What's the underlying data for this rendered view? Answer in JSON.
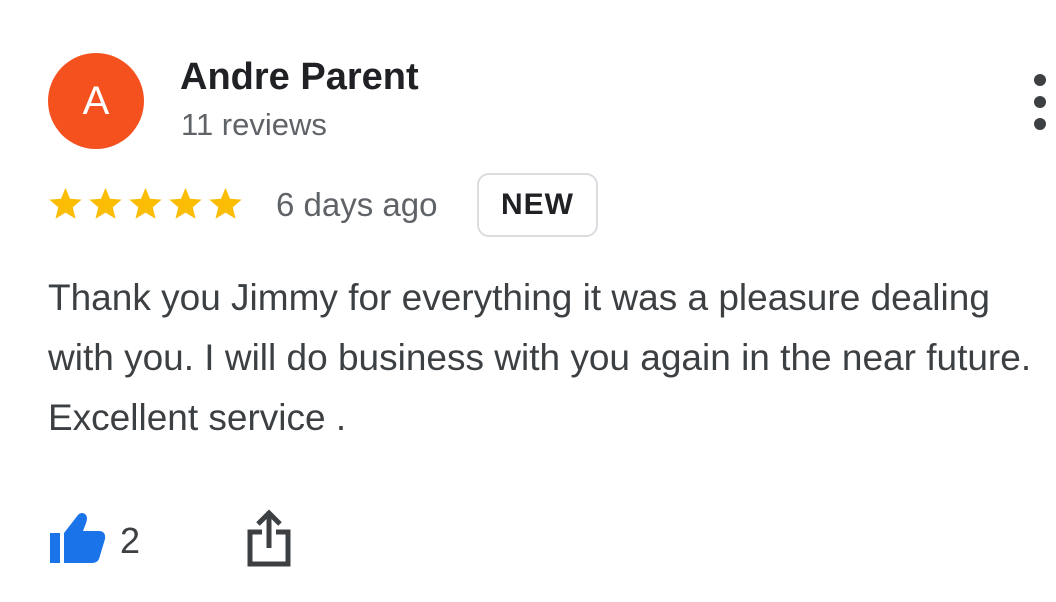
{
  "reviewer": {
    "initial": "A",
    "name": "Andre Parent",
    "review_count": "11 reviews",
    "avatar_color": "#f4511e"
  },
  "rating": {
    "stars": 5,
    "max_stars": 5,
    "star_color": "#fbbc04"
  },
  "review": {
    "date": "6 days ago",
    "badge": "NEW",
    "text": "Thank you Jimmy for everything it was a pleasure dealing with you. I will do business with you again in the near future. Excellent service ."
  },
  "actions": {
    "like_count": "2",
    "like_color": "#1a73e8",
    "icons": {
      "more": "more-vert-icon",
      "like": "thumbs-up-icon",
      "share": "share-icon"
    }
  }
}
